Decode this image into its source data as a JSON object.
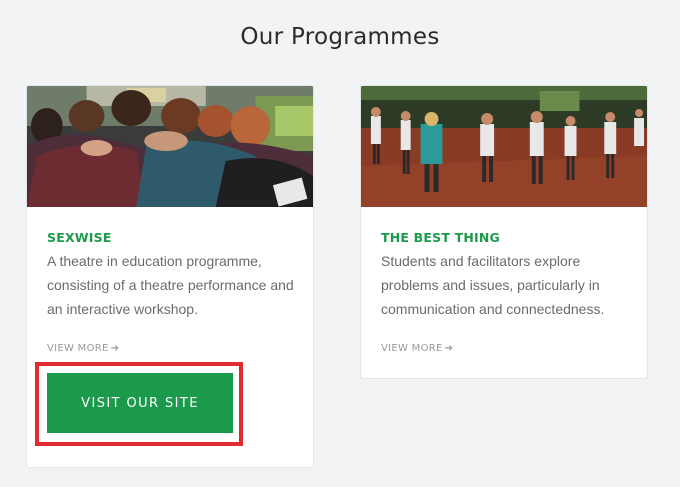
{
  "section": {
    "title": "Our Programmes"
  },
  "programmes": [
    {
      "title": "SEXWISE",
      "description": "A theatre in education programme, consisting of a theatre performance and an interactive workshop.",
      "view_more_label": "VIEW MORE",
      "view_more_icon": "arrow-right-icon",
      "image_icon": "group-hug-photo"
    },
    {
      "title": "THE BEST THING",
      "description": "Students and facilitators explore problems and issues, particularly in communication and connectedness.",
      "view_more_label": "VIEW MORE",
      "view_more_icon": "arrow-right-icon",
      "image_icon": "outdoor-workshop-photo"
    }
  ],
  "cta": {
    "label": "VISIT OUR SITE"
  },
  "colors": {
    "accent": "#1c9a4c",
    "highlight": "#e02b30",
    "background": "#f1f3f4"
  }
}
